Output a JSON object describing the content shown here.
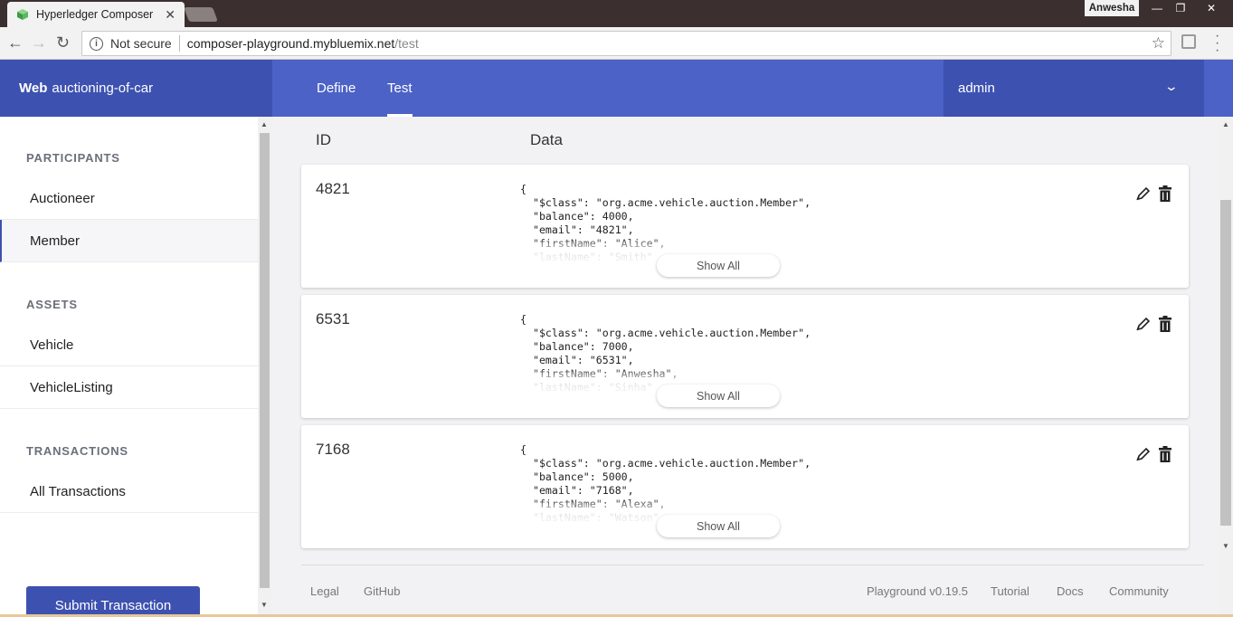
{
  "browser": {
    "tab_title": "Hyperledger Composer",
    "tab_close": "✕",
    "profile": "Anwesha",
    "security_label": "Not secure",
    "url_host": "composer-playground.mybluemix.net",
    "url_path": "/test"
  },
  "header": {
    "brand_bold": "Web",
    "brand_name": "auctioning-of-car",
    "tabs": [
      {
        "label": "Define"
      },
      {
        "label": "Test"
      }
    ],
    "user": "admin"
  },
  "sidebar": {
    "participants_heading": "PARTICIPANTS",
    "participants": [
      {
        "label": "Auctioneer"
      },
      {
        "label": "Member"
      }
    ],
    "assets_heading": "ASSETS",
    "assets": [
      {
        "label": "Vehicle"
      },
      {
        "label": "VehicleListing"
      }
    ],
    "transactions_heading": "TRANSACTIONS",
    "transactions": [
      {
        "label": "All Transactions"
      }
    ],
    "submit_label": "Submit Transaction"
  },
  "table": {
    "id_header": "ID",
    "data_header": "Data",
    "show_all_label": "Show All",
    "rows": [
      {
        "id": "4821",
        "data": "{\n  \"$class\": \"org.acme.vehicle.auction.Member\",\n  \"balance\": 4000,\n  \"email\": \"4821\",\n  \"firstName\": \"Alice\",\n  \"lastName\": \"Smith\"\n}"
      },
      {
        "id": "6531",
        "data": "{\n  \"$class\": \"org.acme.vehicle.auction.Member\",\n  \"balance\": 7000,\n  \"email\": \"6531\",\n  \"firstName\": \"Anwesha\",\n  \"lastName\": \"Sinha\"\n}"
      },
      {
        "id": "7168",
        "data": "{\n  \"$class\": \"org.acme.vehicle.auction.Member\",\n  \"balance\": 5000,\n  \"email\": \"7168\",\n  \"firstName\": \"Alexa\",\n  \"lastName\": \"Watson\"\n}"
      }
    ]
  },
  "footer": {
    "legal": "Legal",
    "github": "GitHub",
    "version": "Playground v0.19.5",
    "tutorial": "Tutorial",
    "docs": "Docs",
    "community": "Community"
  },
  "colors": {
    "primary": "#4c62c6",
    "primary_dark": "#3d51b0"
  }
}
